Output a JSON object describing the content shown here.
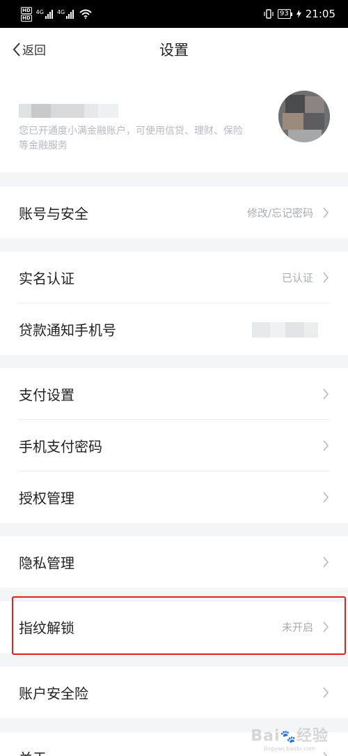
{
  "status_bar": {
    "hd_label": "HD",
    "network_label": "4G",
    "time": "21:05",
    "battery": "93"
  },
  "nav": {
    "back_label": "返回",
    "title": "设置"
  },
  "profile": {
    "description": "您已开通度小满金融账户，可使用信贷、理财、保险等金融服务"
  },
  "settings": {
    "account_security": {
      "label": "账号与安全",
      "value": "修改/忘记密码"
    },
    "real_name": {
      "label": "实名认证",
      "value": "已认证"
    },
    "loan_phone": {
      "label": "贷款通知手机号"
    },
    "payment_settings": {
      "label": "支付设置"
    },
    "payment_password": {
      "label": "手机支付密码"
    },
    "authorization": {
      "label": "授权管理"
    },
    "privacy": {
      "label": "隐私管理"
    },
    "fingerprint": {
      "label": "指纹解锁",
      "value": "未开启"
    },
    "account_insurance": {
      "label": "账户安全险"
    },
    "about": {
      "label": "关于"
    }
  },
  "watermark": {
    "main": "Bai 经验",
    "sub": "jingyan.baidu.com"
  },
  "colors": {
    "highlight": "#e0201f",
    "background": "#f4f5f7"
  }
}
